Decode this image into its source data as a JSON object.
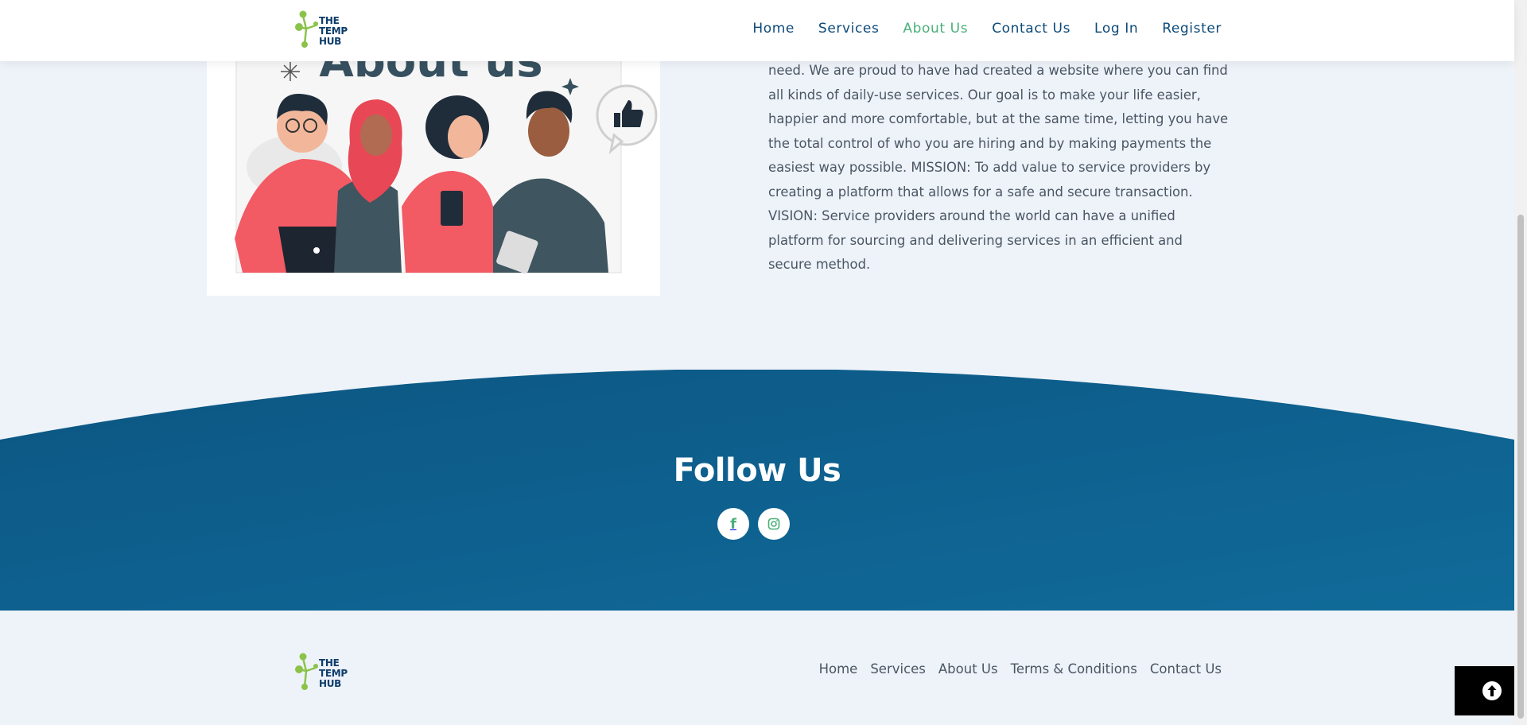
{
  "header": {
    "logo": {
      "line1": "THE",
      "line2": "TEMP",
      "line3": "HUB"
    },
    "nav": [
      {
        "label": "Home"
      },
      {
        "label": "Services"
      },
      {
        "label": "About Us"
      },
      {
        "label": "Contact Us"
      },
      {
        "label": "Log In"
      },
      {
        "label": "Register"
      }
    ],
    "active_nav": "About Us"
  },
  "about": {
    "image_heading": "About us",
    "text": "need. We are proud to have had created a website where you can find all kinds of daily-use services. Our goal is to make your life easier, happier and more comfortable, but at the same time, letting you have the total control of who you are hiring and by making payments the easiest way possible. MISSION: To add value to service providers by creating a platform that allows for a safe and secure transaction. VISION: Service providers around the world can have a unified platform for sourcing and delivering services in an efficient and secure method."
  },
  "follow": {
    "title": "Follow Us",
    "icons": [
      "facebook-icon",
      "instagram-icon"
    ]
  },
  "footer": {
    "logo": {
      "line1": "THE",
      "line2": "TEMP",
      "line3": "HUB"
    },
    "nav": [
      {
        "label": "Home"
      },
      {
        "label": "Services"
      },
      {
        "label": "About Us"
      },
      {
        "label": "Terms & Conditions"
      },
      {
        "label": "Contact Us"
      }
    ]
  },
  "back_to_top_icon": "arrow-up-circle-icon",
  "colors": {
    "brand_blue": "#0d5c8a",
    "nav_text": "#0d4a78",
    "active_green": "#4caf7a",
    "coral": "#f25a64"
  }
}
